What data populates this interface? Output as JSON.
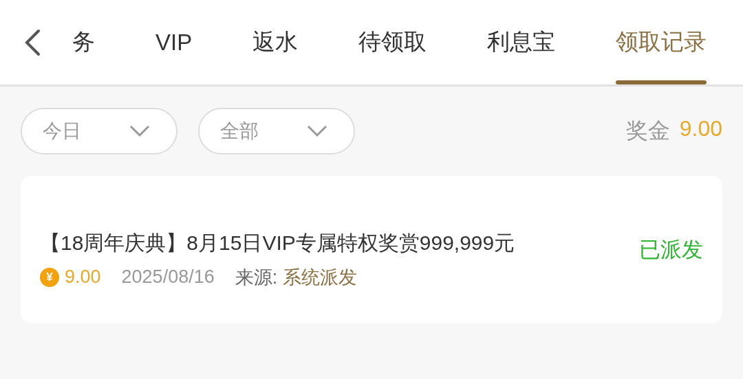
{
  "tabs": [
    {
      "label": "务",
      "selected": false
    },
    {
      "label": "VIP",
      "selected": false
    },
    {
      "label": "返水",
      "selected": false
    },
    {
      "label": "待领取",
      "selected": false
    },
    {
      "label": "利息宝",
      "selected": false
    },
    {
      "label": "领取记录",
      "selected": true
    }
  ],
  "filters": [
    {
      "value": "今日"
    },
    {
      "value": "全部"
    }
  ],
  "bonus": {
    "label": "奖金",
    "amount": "9.00"
  },
  "records": [
    {
      "title": "【18周年庆典】8月15日VIP专属特权奖赏999,999元",
      "status": "已派发",
      "coin_symbol": "¥",
      "amount": "9.00",
      "date": "2025/08/16",
      "source_label": "来源:",
      "source": "系统派发"
    }
  ]
}
